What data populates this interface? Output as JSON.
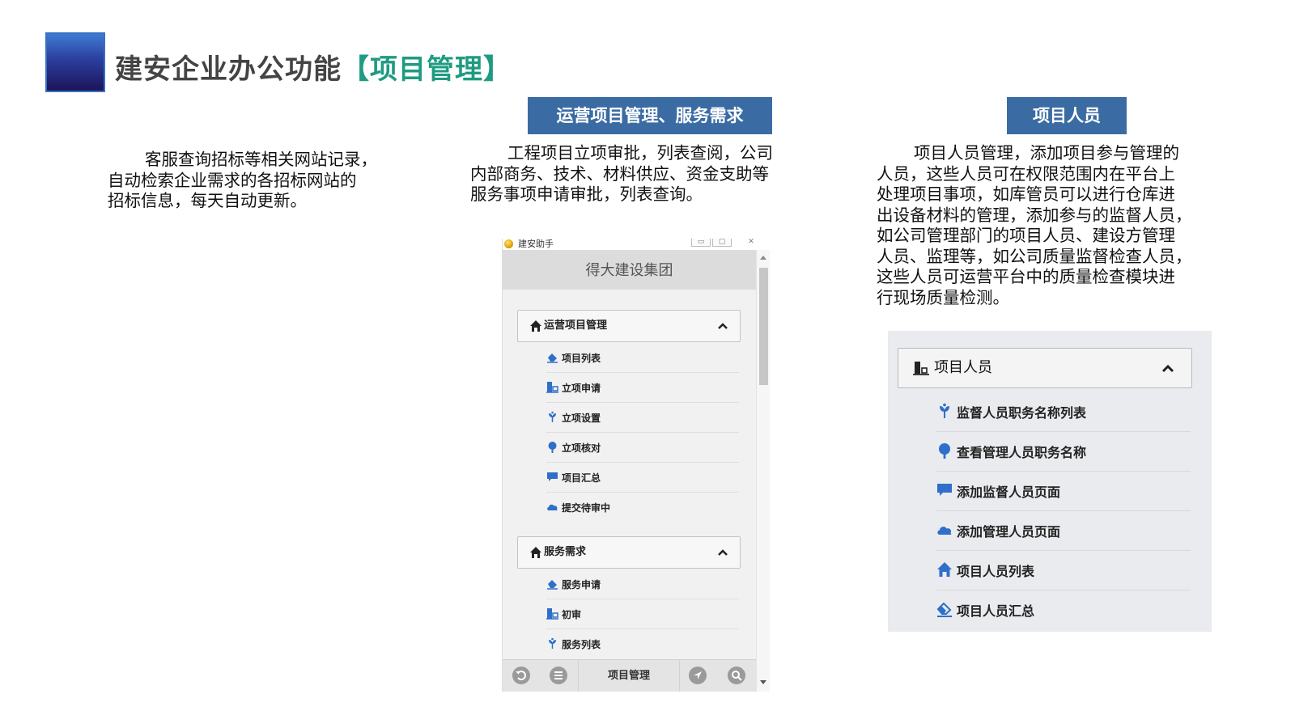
{
  "slide": {
    "title_main": "建安企业办公功能",
    "title_accent": "【项目管理】"
  },
  "left_text": {
    "lines": [
      "客服查询招标等相关网站记录，",
      "自动检索企业需求的各招标网站的",
      "招标信息，每天自动更新。"
    ]
  },
  "middle": {
    "badge": "运营项目管理、服务需求",
    "lines": [
      "工程项目立项审批，列表查阅，公司",
      "内部商务、技术、材料供应、资金支助等",
      "服务事项申请审批，列表查询。"
    ]
  },
  "right": {
    "badge": "项目人员",
    "lines": [
      "项目人员管理，添加项目参与管理的",
      "人员，这些人员可在权限范围内在平台上",
      "处理项目事项，如库管员可以进行仓库进",
      "出设备材料的管理，添加参与的监督人员，",
      "如公司管理部门的项目人员、建设方管理",
      "人员、监理等，如公司质量监督检查人员，",
      "这些人员可运营平台中的质量检查模块进",
      "行现场质量检测。"
    ]
  },
  "phone": {
    "window_title": "建安助手",
    "header": "得大建设集团",
    "groups": [
      {
        "label": "运营项目管理",
        "items": [
          "项目列表",
          "立项申请",
          "立项设置",
          "立项核对",
          "项目汇总",
          "提交待审中"
        ]
      },
      {
        "label": "服务需求",
        "items": [
          "服务申请",
          "初审",
          "服务列表"
        ]
      }
    ],
    "bottom_title": "项目管理"
  },
  "panel": {
    "header": "项目人员",
    "items": [
      "监督人员职务名称列表",
      "查看管理人员职务名称",
      "添加监督人员页面",
      "添加管理人员页面",
      "项目人员列表",
      "项目人员汇总"
    ]
  },
  "colors": {
    "badge_bg": "#3b6ba3",
    "title_accent": "#1f9b82",
    "icon_blue": "#2f6fc9"
  }
}
